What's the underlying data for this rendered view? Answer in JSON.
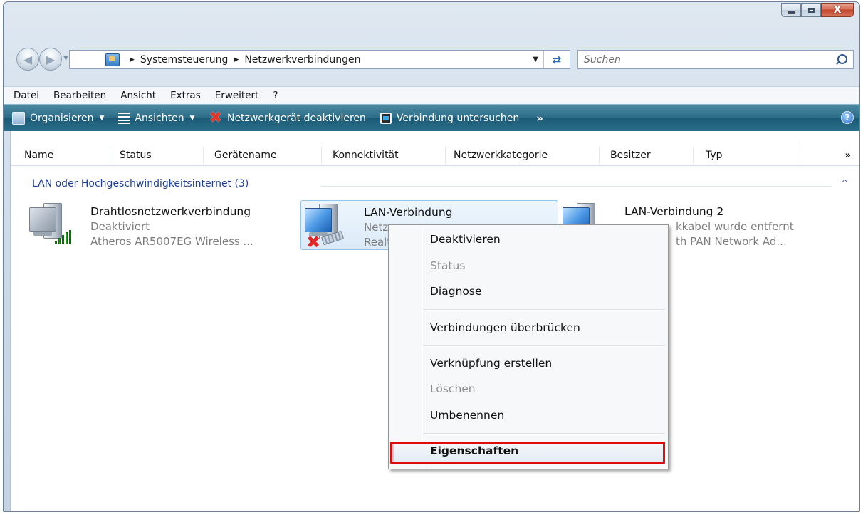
{
  "window": {
    "caption": {
      "minimize": "",
      "maximize": "",
      "close": "X"
    }
  },
  "nav": {
    "breadcrumb": [
      "Systemsteuerung",
      "Netzwerkverbindungen"
    ],
    "search_placeholder": "Suchen"
  },
  "menubar": [
    "Datei",
    "Bearbeiten",
    "Ansicht",
    "Extras",
    "Erweitert",
    "?"
  ],
  "toolbar": {
    "organize": "Organisieren",
    "views": "Ansichten",
    "disable_device": "Netzwerkgerät deaktivieren",
    "diagnose": "Verbindung untersuchen",
    "more": "»",
    "help": "?"
  },
  "columns": [
    "Name",
    "Status",
    "Gerätename",
    "Konnektivität",
    "Netzwerkkategorie",
    "Besitzer",
    "Typ"
  ],
  "columns_more": "»",
  "group": {
    "label": "LAN oder Hochgeschwindigkeitsinternet (3)",
    "collapse": "^"
  },
  "items": [
    {
      "name": "Drahtlosnetzwerkverbindung",
      "status": "Deaktiviert",
      "device": "Atheros AR5007EG Wireless ..."
    },
    {
      "name": "LAN-Verbindung",
      "status": "Netzv",
      "device": "Realte"
    },
    {
      "name": "LAN-Verbindung 2",
      "status": "kkabel wurde entfernt",
      "device": "th PAN Network Ad..."
    }
  ],
  "context_menu": [
    {
      "label": "Deaktivieren",
      "enabled": true
    },
    {
      "label": "Status",
      "enabled": false
    },
    {
      "label": "Diagnose",
      "enabled": true
    },
    {
      "label": "Verbindungen überbrücken",
      "enabled": true
    },
    {
      "label": "Verknüpfung erstellen",
      "enabled": true
    },
    {
      "label": "Löschen",
      "enabled": false
    },
    {
      "label": "Umbenennen",
      "enabled": true
    },
    {
      "label": "Eigenschaften",
      "enabled": true,
      "default": true,
      "highlighted": true
    }
  ],
  "colors": {
    "toolbar": "#2d6d88",
    "group_header": "#1e3f99",
    "highlight_border": "#e00b0b"
  }
}
